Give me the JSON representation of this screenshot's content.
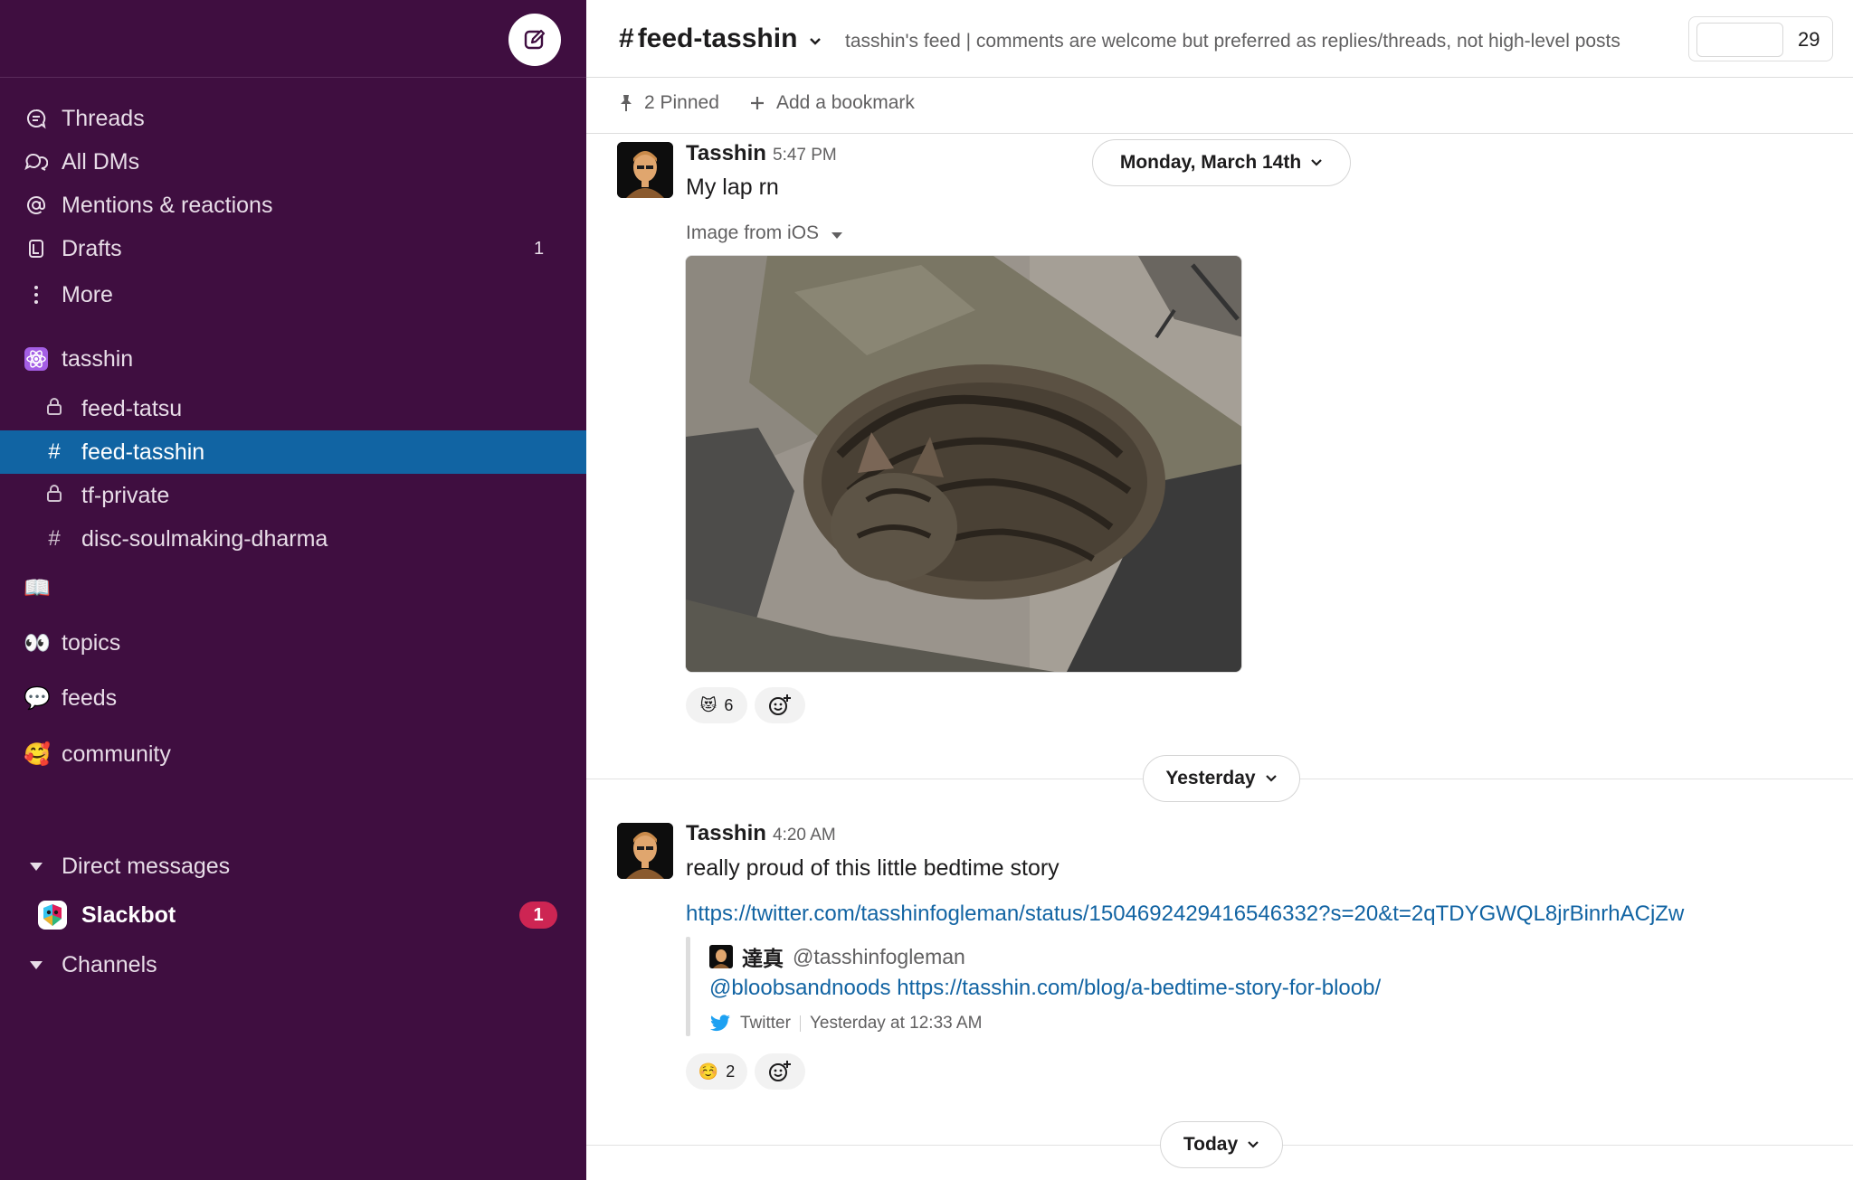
{
  "sidebar": {
    "nav": [
      {
        "label": "Threads",
        "icon": "threads-icon"
      },
      {
        "label": "All DMs",
        "icon": "dms-icon"
      },
      {
        "label": "Mentions & reactions",
        "icon": "at-icon"
      },
      {
        "label": "Drafts",
        "icon": "drafts-icon",
        "count": "1"
      },
      {
        "label": "More",
        "icon": "more-icon"
      }
    ],
    "workspace_section": "tasshin",
    "channels": [
      {
        "label": "feed-tatsu",
        "type": "private"
      },
      {
        "label": "feed-tasshin",
        "type": "public",
        "active": true
      },
      {
        "label": "tf-private",
        "type": "private"
      },
      {
        "label": "disc-soulmaking-dharma",
        "type": "public"
      }
    ],
    "sections": [
      {
        "label": "topics",
        "emoji": "👀"
      },
      {
        "label": "feeds",
        "emoji": "💬"
      },
      {
        "label": "community",
        "emoji": "🥰"
      }
    ],
    "book_emoji": "📖",
    "direct_messages_label": "Direct messages",
    "slackbot": {
      "label": "Slackbot",
      "badge": "1"
    },
    "channels_label": "Channels"
  },
  "header": {
    "channel_name": "feed-tasshin",
    "topic": "tasshin's feed | comments are welcome but preferred as replies/threads, not high-level posts",
    "member_count": "29"
  },
  "bookmarks": {
    "pinned": "2 Pinned",
    "add": "Add a bookmark"
  },
  "messages": [
    {
      "author": "Tasshin",
      "time": "5:47 PM",
      "text": "My lap rn",
      "attachment_label": "Image from iOS",
      "reactions": [
        {
          "emoji": "😻",
          "count": "6"
        }
      ]
    },
    {
      "author": "Tasshin",
      "time": "4:20 AM",
      "text": "really proud of this little bedtime story",
      "link": "https://twitter.com/tasshinfogleman/status/1504692429416546332?s=20&t=2qTDYGWQL8jrBinrhACjZw",
      "unfurl": {
        "name": "達真",
        "handle": "@tasshinfogleman",
        "mention": "@bloobsandnoods",
        "url": "https://tasshin.com/blog/a-bedtime-story-for-bloob/",
        "source": "Twitter",
        "date": "Yesterday at 12:33 AM"
      },
      "reactions": [
        {
          "emoji": "☺️",
          "count": "2"
        }
      ]
    }
  ],
  "date_dividers": {
    "first": "Monday, March 14th",
    "second": "Yesterday",
    "third": "Today"
  },
  "colors": {
    "sidebar_bg": "#3f0e40",
    "active_channel": "#1164a3",
    "badge": "#cd2553",
    "link": "#1264a3"
  }
}
